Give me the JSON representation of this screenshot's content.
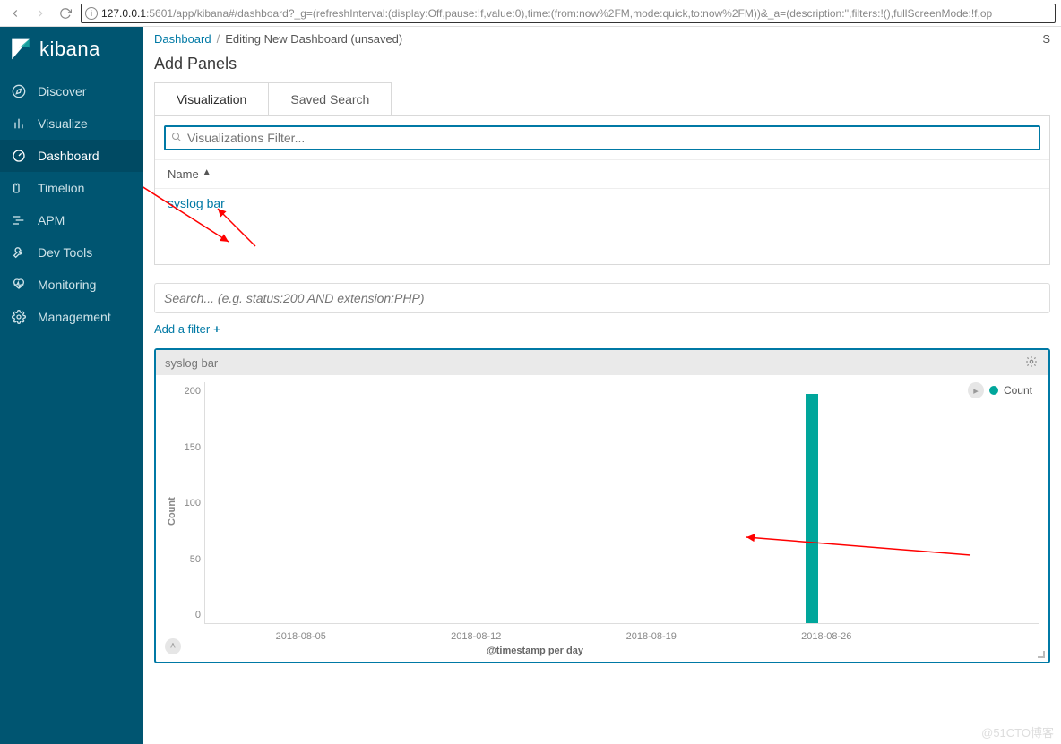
{
  "browser": {
    "url_host": "127.0.0.1",
    "url_rest": ":5601/app/kibana#/dashboard?_g=(refreshInterval:(display:Off,pause:!f,value:0),time:(from:now%2FM,mode:quick,to:now%2FM))&_a=(description:'',filters:!(),fullScreenMode:!f,op"
  },
  "logo": {
    "text": "kibana"
  },
  "nav": {
    "items": [
      {
        "label": "Discover"
      },
      {
        "label": "Visualize"
      },
      {
        "label": "Dashboard"
      },
      {
        "label": "Timelion"
      },
      {
        "label": "APM"
      },
      {
        "label": "Dev Tools"
      },
      {
        "label": "Monitoring"
      },
      {
        "label": "Management"
      }
    ]
  },
  "breadcrumb": {
    "root": "Dashboard",
    "current": "Editing New Dashboard (unsaved)",
    "right": "S"
  },
  "add_panels": {
    "title": "Add Panels",
    "tabs": {
      "viz": "Visualization",
      "saved": "Saved Search"
    },
    "filter_placeholder": "Visualizations Filter...",
    "table": {
      "header": "Name",
      "rows": [
        "syslog bar"
      ]
    }
  },
  "search": {
    "placeholder": "Search... (e.g. status:200 AND extension:PHP)"
  },
  "filter_link": "Add a filter",
  "viz_panel": {
    "title": "syslog bar"
  },
  "legend": {
    "label": "Count"
  },
  "watermark": "@51CTO博客",
  "chart_data": {
    "type": "bar",
    "title": "syslog bar",
    "xlabel": "@timestamp per day",
    "ylabel": "Count",
    "ylim": [
      0,
      200
    ],
    "y_ticks": [
      200,
      150,
      100,
      50,
      0
    ],
    "categories": [
      "2018-08-05",
      "2018-08-12",
      "2018-08-19",
      "2018-08-26"
    ],
    "series": [
      {
        "name": "Count",
        "x": "2018-08-24",
        "value": 190,
        "color": "#00a69b"
      }
    ]
  }
}
